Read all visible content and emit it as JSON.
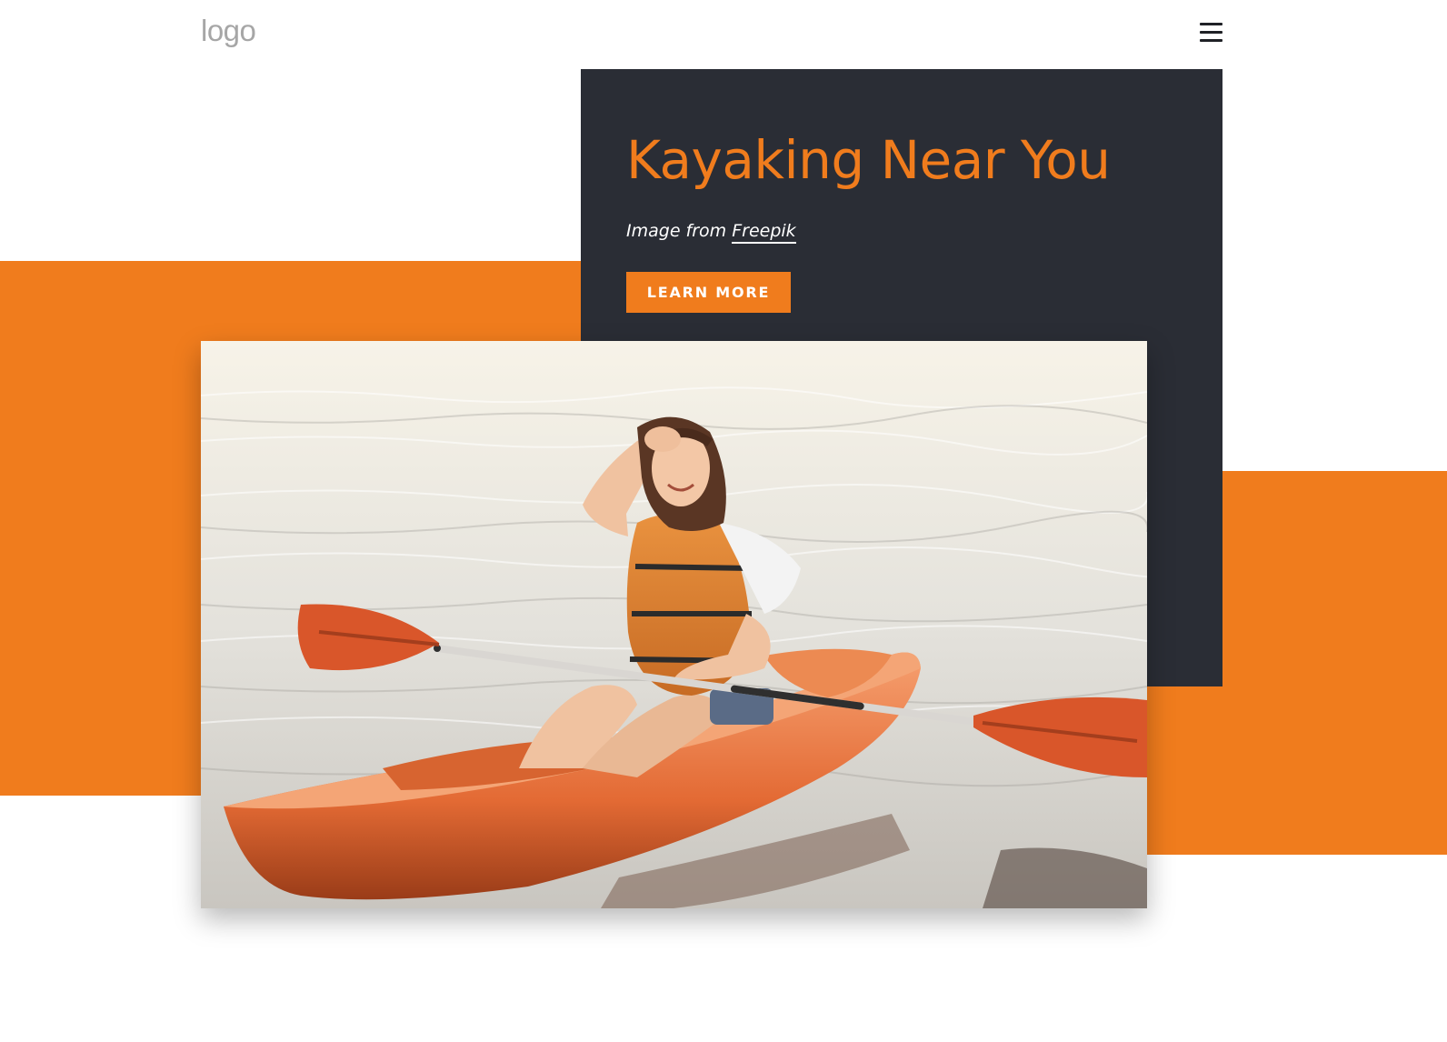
{
  "header": {
    "logo_text": "logo",
    "menu_icon": "hamburger-menu-icon"
  },
  "hero": {
    "title": "Kayaking Near You",
    "credit_prefix": "Image from ",
    "credit_link": "Freepik",
    "button_label": "LEARN MORE"
  },
  "photo": {
    "subject": "kayak-photo"
  },
  "colors": {
    "accent": "#f07c1d",
    "dark_panel": "#2a2d35",
    "background": "#ffffff"
  }
}
